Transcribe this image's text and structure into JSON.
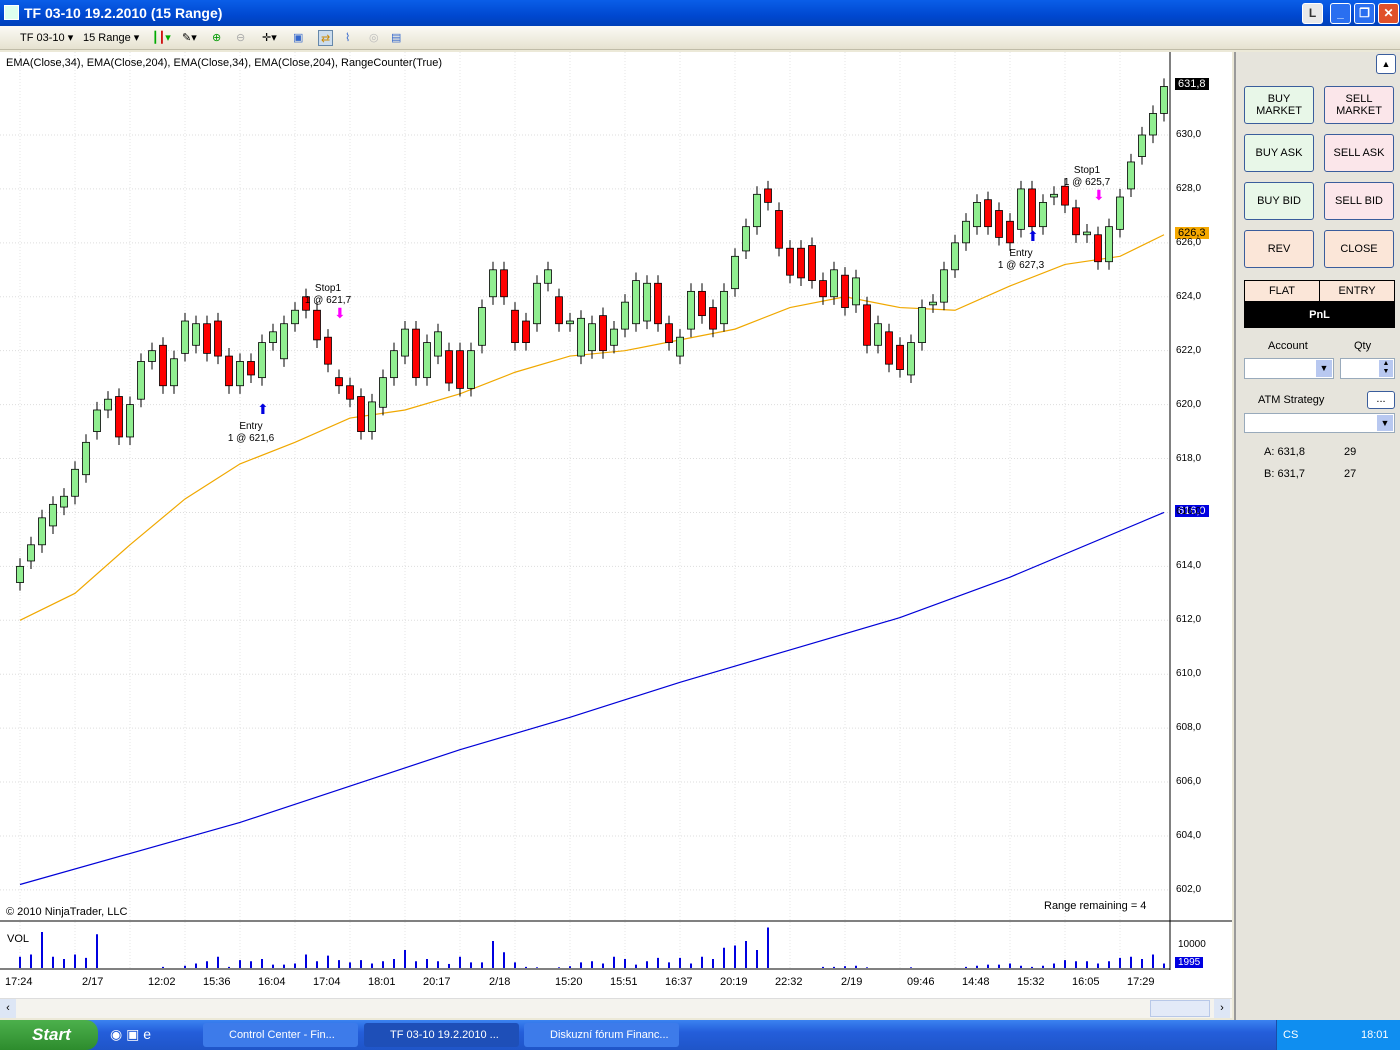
{
  "window": {
    "title": "TF 03-10  19.2.2010 (15 Range)",
    "badge": "L"
  },
  "toolbar": {
    "instrument": "TF 03-10",
    "period": "15 Range"
  },
  "chart": {
    "indicator_label": "EMA(Close,34), EMA(Close,204), EMA(Close,34), EMA(Close,204), RangeCounter(True)",
    "copyright": "© 2010 NinjaTrader, LLC",
    "range_remaining": "Range remaining = 4",
    "last_price": "631,8",
    "ema34_label": "626,3",
    "ema204_label": "616,0",
    "y_ticks": [
      "630,0",
      "628,0",
      "626,0",
      "624,0",
      "622,0",
      "620,0",
      "618,0",
      "616,0",
      "614,0",
      "612,0",
      "610,0",
      "608,0",
      "606,0",
      "604,0",
      "602,0"
    ],
    "x_ticks": [
      [
        "17:24",
        0
      ],
      [
        "2/17",
        7
      ],
      [
        "12:02",
        13
      ],
      [
        "15:36",
        18
      ],
      [
        "16:04",
        23
      ],
      [
        "17:04",
        28
      ],
      [
        "18:01",
        33
      ],
      [
        "20:17",
        38
      ],
      [
        "2/18",
        44
      ],
      [
        "15:20",
        50
      ],
      [
        "15:51",
        55
      ],
      [
        "16:37",
        60
      ],
      [
        "20:19",
        65
      ],
      [
        "22:32",
        70
      ],
      [
        "2/19",
        76
      ],
      [
        "09:46",
        82
      ],
      [
        "14:48",
        87
      ],
      [
        "15:32",
        92
      ],
      [
        "16:05",
        97
      ],
      [
        "17:29",
        102
      ]
    ],
    "annotations": [
      {
        "l1": "Entry",
        "l2": "1 @ 621,6",
        "idx": 21,
        "price": 619.4
      },
      {
        "l1": "Stop1",
        "l2": "1 @ 621,7",
        "idx": 28,
        "price": 624.5
      },
      {
        "l1": "Entry",
        "l2": "1 @ 627,3",
        "idx": 91,
        "price": 625.8
      },
      {
        "l1": "Stop1",
        "l2": "1 @ 625,7",
        "idx": 97,
        "price": 628.9
      }
    ],
    "volume": {
      "label": "VOL",
      "tick": "10000",
      "last": "1995"
    }
  },
  "chart_data": {
    "type": "candlestick",
    "ylim": [
      601.5,
      632.5
    ],
    "candles": [
      [
        613.4,
        614.0
      ],
      [
        614.2,
        614.8
      ],
      [
        614.8,
        615.8
      ],
      [
        615.5,
        616.3
      ],
      [
        616.2,
        616.6
      ],
      [
        616.6,
        617.6
      ],
      [
        617.4,
        618.6
      ],
      [
        619.0,
        619.8
      ],
      [
        619.8,
        620.2
      ],
      [
        620.3,
        618.8
      ],
      [
        618.8,
        620.0
      ],
      [
        620.2,
        621.6
      ],
      [
        621.6,
        622.0
      ],
      [
        622.2,
        620.7
      ],
      [
        620.7,
        621.7
      ],
      [
        621.9,
        623.1
      ],
      [
        622.2,
        623.0
      ],
      [
        623.0,
        621.9
      ],
      [
        623.1,
        621.8
      ],
      [
        621.8,
        620.7
      ],
      [
        620.7,
        621.6
      ],
      [
        621.6,
        621.1
      ],
      [
        621.0,
        622.3
      ],
      [
        622.3,
        622.7
      ],
      [
        621.7,
        623.0
      ],
      [
        623.0,
        623.5
      ],
      [
        624.0,
        623.5
      ],
      [
        623.5,
        622.4
      ],
      [
        622.5,
        621.5
      ],
      [
        621.0,
        620.7
      ],
      [
        620.7,
        620.2
      ],
      [
        620.3,
        619.0
      ],
      [
        619.0,
        620.1
      ],
      [
        619.9,
        621.0
      ],
      [
        621.0,
        622.0
      ],
      [
        621.8,
        622.8
      ],
      [
        622.8,
        621.0
      ],
      [
        621.0,
        622.3
      ],
      [
        621.8,
        622.7
      ],
      [
        622.0,
        620.8
      ],
      [
        622.0,
        620.6
      ],
      [
        620.6,
        622.0
      ],
      [
        622.2,
        623.6
      ],
      [
        624.0,
        625.0
      ],
      [
        625.0,
        624.0
      ],
      [
        623.5,
        622.3
      ],
      [
        623.1,
        622.3
      ],
      [
        623.0,
        624.5
      ],
      [
        624.5,
        625.0
      ],
      [
        624.0,
        623.0
      ],
      [
        623.0,
        623.1
      ],
      [
        621.8,
        623.2
      ],
      [
        622.0,
        623.0
      ],
      [
        623.3,
        622.0
      ],
      [
        622.2,
        622.8
      ],
      [
        622.8,
        623.8
      ],
      [
        623.0,
        624.6
      ],
      [
        623.1,
        624.5
      ],
      [
        624.5,
        623.0
      ],
      [
        623.0,
        622.3
      ],
      [
        621.8,
        622.5
      ],
      [
        622.8,
        624.2
      ],
      [
        624.2,
        623.3
      ],
      [
        623.6,
        622.8
      ],
      [
        623.0,
        624.2
      ],
      [
        624.3,
        625.5
      ],
      [
        625.7,
        626.6
      ],
      [
        626.6,
        627.8
      ],
      [
        628.0,
        627.5
      ],
      [
        627.2,
        625.8
      ],
      [
        625.8,
        624.8
      ],
      [
        625.8,
        624.7
      ],
      [
        625.9,
        624.6
      ],
      [
        624.6,
        624.0
      ],
      [
        624.0,
        625.0
      ],
      [
        624.8,
        623.6
      ],
      [
        623.7,
        624.7
      ],
      [
        623.7,
        622.2
      ],
      [
        622.2,
        623.0
      ],
      [
        622.7,
        621.5
      ],
      [
        622.2,
        621.3
      ],
      [
        621.1,
        622.3
      ],
      [
        622.3,
        623.6
      ],
      [
        623.7,
        623.8
      ],
      [
        623.8,
        625.0
      ],
      [
        625.0,
        626.0
      ],
      [
        626.0,
        626.8
      ],
      [
        626.6,
        627.5
      ],
      [
        627.6,
        626.6
      ],
      [
        627.2,
        626.2
      ],
      [
        626.8,
        626.0
      ],
      [
        626.5,
        628.0
      ],
      [
        628.0,
        626.6
      ],
      [
        626.6,
        627.5
      ],
      [
        627.7,
        627.8
      ],
      [
        628.1,
        627.4
      ],
      [
        627.3,
        626.3
      ],
      [
        626.3,
        626.4
      ],
      [
        626.3,
        625.3
      ],
      [
        625.3,
        626.6
      ],
      [
        626.5,
        627.7
      ],
      [
        628.0,
        629.0
      ],
      [
        629.2,
        630.0
      ],
      [
        630.0,
        630.8
      ],
      [
        630.8,
        631.8
      ]
    ],
    "ema34": [
      [
        0,
        612.0
      ],
      [
        5,
        613.0
      ],
      [
        10,
        614.8
      ],
      [
        15,
        616.5
      ],
      [
        20,
        617.8
      ],
      [
        25,
        618.6
      ],
      [
        30,
        619.5
      ],
      [
        35,
        619.8
      ],
      [
        40,
        620.4
      ],
      [
        45,
        621.2
      ],
      [
        50,
        621.8
      ],
      [
        55,
        622.0
      ],
      [
        60,
        622.4
      ],
      [
        65,
        622.8
      ],
      [
        70,
        623.6
      ],
      [
        75,
        624.0
      ],
      [
        80,
        623.6
      ],
      [
        85,
        623.5
      ],
      [
        90,
        624.4
      ],
      [
        95,
        625.2
      ],
      [
        100,
        625.5
      ],
      [
        104,
        626.3
      ]
    ],
    "ema204": [
      [
        0,
        602.2
      ],
      [
        20,
        604.5
      ],
      [
        40,
        607.2
      ],
      [
        50,
        608.4
      ],
      [
        60,
        609.7
      ],
      [
        70,
        610.9
      ],
      [
        80,
        612.1
      ],
      [
        90,
        613.6
      ],
      [
        104,
        616.0
      ]
    ],
    "volume": [
      5000,
      6000,
      16000,
      5000,
      4000,
      6000,
      4500,
      15000,
      0,
      0,
      0,
      0,
      0,
      500,
      0,
      1000,
      2000,
      3000,
      5000,
      500,
      3500,
      3000,
      4000,
      1500,
      1500,
      2000,
      6000,
      3000,
      5500,
      3500,
      2500,
      3500,
      2000,
      3000,
      4000,
      8000,
      3000,
      4000,
      3000,
      1800,
      5000,
      2500,
      2500,
      12000,
      7000,
      2500,
      500,
      300,
      0,
      300,
      800,
      2500,
      3000,
      2000,
      5000,
      4000,
      1500,
      3000,
      4500,
      2500,
      4500,
      2000,
      5000,
      4000,
      9000,
      10000,
      12000,
      8000,
      18000,
      0,
      0,
      0,
      0,
      500,
      500,
      800,
      1000,
      300,
      0,
      0,
      0,
      300,
      0,
      0,
      0,
      0,
      500,
      1000,
      1500,
      1500,
      2000,
      1000,
      500,
      1000,
      2000,
      3500,
      3000,
      3000,
      2000,
      3000,
      4500,
      5000,
      4000,
      6000,
      1995
    ]
  },
  "panel": {
    "buy_market": "BUY MARKET",
    "sell_market": "SELL MARKET",
    "buy_ask": "BUY ASK",
    "sell_ask": "SELL ASK",
    "buy_bid": "BUY BID",
    "sell_bid": "SELL BID",
    "rev": "REV",
    "close": "CLOSE",
    "flat": "FLAT",
    "entry": "ENTRY",
    "pnl": "PnL",
    "account": "Account",
    "qty": "Qty",
    "atm": "ATM Strategy",
    "atm_btn": "...",
    "ask": "A: 631,8",
    "ask_size": "29",
    "bid": "B: 631,7",
    "bid_size": "27"
  },
  "taskbar": {
    "start": "Start",
    "tasks": [
      "Control Center - Fin...",
      "TF 03-10  19.2.2010 ...",
      "Diskuzní fórum Financ..."
    ],
    "lang": "CS",
    "clock": "18:01"
  }
}
